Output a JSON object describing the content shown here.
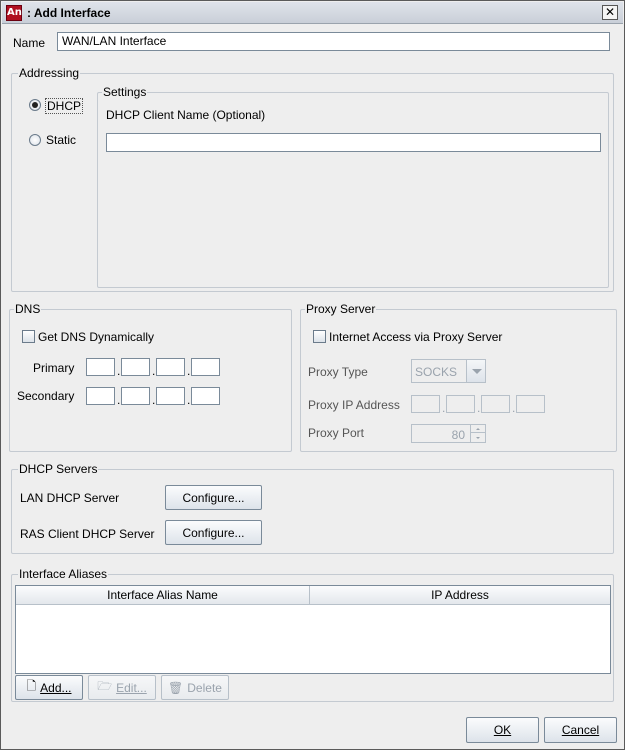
{
  "window": {
    "title": ": Add Interface",
    "app_icon": "An"
  },
  "name_field": {
    "label": "Name",
    "value": "WAN/LAN Interface"
  },
  "addressing": {
    "label": "Addressing",
    "dhcp_label": "DHCP",
    "static_label": "Static",
    "selected": "DHCP",
    "settings": {
      "label": "Settings",
      "client_name_label": "DHCP Client Name (Optional)",
      "client_name_value": ""
    }
  },
  "dns": {
    "label": "DNS",
    "dynamic_label": "Get DNS Dynamically",
    "dynamic_checked": false,
    "primary_label": "Primary",
    "secondary_label": "Secondary",
    "primary_octets": [
      "",
      "",
      "",
      ""
    ],
    "secondary_octets": [
      "",
      "",
      "",
      ""
    ],
    "dot": "."
  },
  "proxy": {
    "label": "Proxy Server",
    "internet_access_label": "Internet Access via Proxy Server",
    "internet_access_checked": false,
    "type_label": "Proxy Type",
    "type_value": "SOCKS",
    "ip_label": "Proxy IP Address",
    "port_label": "Proxy Port",
    "port_value": "80"
  },
  "dhcp_servers": {
    "label": "DHCP Servers",
    "lan_label": "LAN DHCP Server",
    "ras_label": "RAS Client DHCP Server",
    "configure_label": "Configure..."
  },
  "aliases": {
    "label": "Interface Aliases",
    "columns": [
      "Interface Alias Name",
      "IP Address"
    ],
    "rows": [],
    "add_label": "Add...",
    "edit_label": "Edit...",
    "delete_label": "Delete"
  },
  "footer": {
    "ok_label": "OK",
    "cancel_label": "Cancel"
  },
  "icons": {
    "add": "add-document-icon",
    "edit": "folder-open-icon",
    "delete": "trash-icon"
  },
  "colors": {
    "title_bar": "#d4d9e0",
    "disabled_text": "#9aa3ad",
    "panel_bg": "#eeeeee"
  }
}
